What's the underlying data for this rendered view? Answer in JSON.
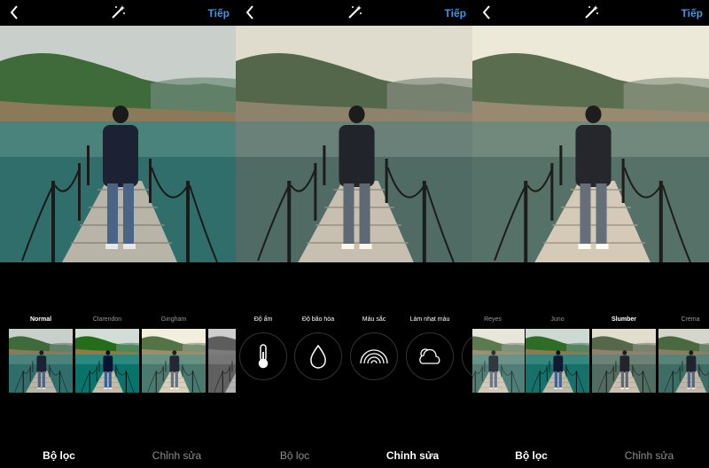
{
  "screens": [
    {
      "next_label": "Tiếp",
      "filters": [
        "Normal",
        "Clarendon",
        "Gingham",
        "M"
      ],
      "active_filter": "Normal",
      "tabs": {
        "filter": "Bộ lọc",
        "edit": "Chỉnh sửa"
      },
      "active_tab": "filter"
    },
    {
      "next_label": "Tiếp",
      "tools": [
        {
          "label": "Độ ấm",
          "icon": "thermometer-icon"
        },
        {
          "label": "Độ bão hòa",
          "icon": "droplet-icon"
        },
        {
          "label": "Màu sắc",
          "icon": "rainbow-icon"
        },
        {
          "label": "Làm nhạt màu",
          "icon": "cloud-icon"
        }
      ],
      "tabs": {
        "filter": "Bộ lọc",
        "edit": "Chỉnh sửa"
      },
      "active_tab": "edit"
    },
    {
      "next_label": "Tiếp",
      "filters": [
        "Reyes",
        "Juno",
        "Slumber",
        "Crema"
      ],
      "active_filter": "Slumber",
      "tabs": {
        "filter": "Bộ lọc",
        "edit": "Chỉnh sửa"
      },
      "active_tab": "filter"
    }
  ],
  "colors": {
    "accent": "#3897f0",
    "background": "#000000",
    "inactive_text": "#8e8e8e"
  }
}
